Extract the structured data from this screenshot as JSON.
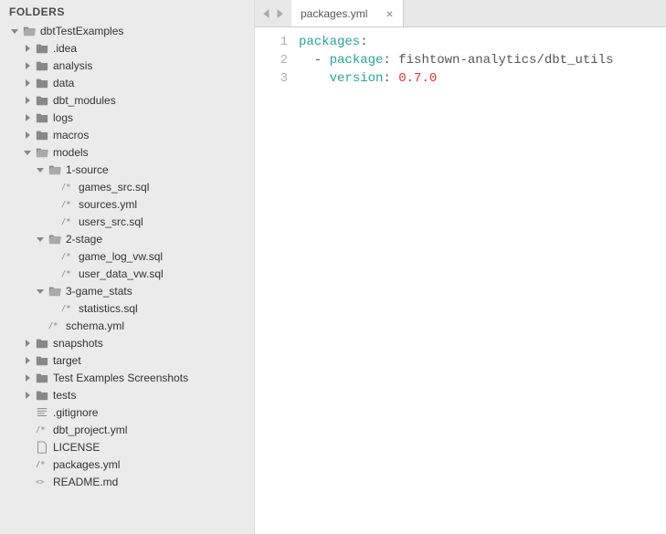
{
  "sidebar": {
    "title": "FOLDERS",
    "tree": [
      {
        "depth": 0,
        "arrow": "down",
        "icon": "folder-open",
        "label": "dbtTestExamples"
      },
      {
        "depth": 1,
        "arrow": "right",
        "icon": "folder",
        "label": ".idea"
      },
      {
        "depth": 1,
        "arrow": "right",
        "icon": "folder",
        "label": "analysis"
      },
      {
        "depth": 1,
        "arrow": "right",
        "icon": "folder",
        "label": "data"
      },
      {
        "depth": 1,
        "arrow": "right",
        "icon": "folder",
        "label": "dbt_modules"
      },
      {
        "depth": 1,
        "arrow": "right",
        "icon": "folder",
        "label": "logs"
      },
      {
        "depth": 1,
        "arrow": "right",
        "icon": "folder",
        "label": "macros"
      },
      {
        "depth": 1,
        "arrow": "down",
        "icon": "folder-open",
        "label": "models"
      },
      {
        "depth": 2,
        "arrow": "down",
        "icon": "folder-open",
        "label": "1-source"
      },
      {
        "depth": 3,
        "arrow": "blank",
        "icon": "file-code",
        "label": "games_src.sql"
      },
      {
        "depth": 3,
        "arrow": "blank",
        "icon": "file-code",
        "label": "sources.yml"
      },
      {
        "depth": 3,
        "arrow": "blank",
        "icon": "file-code",
        "label": "users_src.sql"
      },
      {
        "depth": 2,
        "arrow": "down",
        "icon": "folder-open",
        "label": "2-stage"
      },
      {
        "depth": 3,
        "arrow": "blank",
        "icon": "file-code",
        "label": "game_log_vw.sql"
      },
      {
        "depth": 3,
        "arrow": "blank",
        "icon": "file-code",
        "label": "user_data_vw.sql"
      },
      {
        "depth": 2,
        "arrow": "down",
        "icon": "folder-open",
        "label": "3-game_stats"
      },
      {
        "depth": 3,
        "arrow": "blank",
        "icon": "file-code",
        "label": "statistics.sql"
      },
      {
        "depth": 2,
        "arrow": "blank",
        "icon": "file-code",
        "label": "schema.yml"
      },
      {
        "depth": 1,
        "arrow": "right",
        "icon": "folder",
        "label": "snapshots"
      },
      {
        "depth": 1,
        "arrow": "right",
        "icon": "folder",
        "label": "target"
      },
      {
        "depth": 1,
        "arrow": "right",
        "icon": "folder",
        "label": "Test Examples Screenshots"
      },
      {
        "depth": 1,
        "arrow": "right",
        "icon": "folder",
        "label": "tests"
      },
      {
        "depth": 1,
        "arrow": "blank",
        "icon": "file-lines",
        "label": ".gitignore"
      },
      {
        "depth": 1,
        "arrow": "blank",
        "icon": "file-code",
        "label": "dbt_project.yml"
      },
      {
        "depth": 1,
        "arrow": "blank",
        "icon": "file",
        "label": "LICENSE"
      },
      {
        "depth": 1,
        "arrow": "blank",
        "icon": "file-code",
        "label": "packages.yml"
      },
      {
        "depth": 1,
        "arrow": "blank",
        "icon": "file-md",
        "label": "README.md"
      }
    ]
  },
  "editor": {
    "tab": {
      "name": "packages.yml"
    },
    "lines": [
      {
        "num": "1",
        "spans": [
          {
            "t": "packages",
            "c": "tok-key"
          },
          {
            "t": ":",
            "c": "tok-punct"
          }
        ]
      },
      {
        "num": "2",
        "spans": [
          {
            "t": "  - ",
            "c": "tok-punct"
          },
          {
            "t": "package",
            "c": "tok-key"
          },
          {
            "t": ": ",
            "c": "tok-punct"
          },
          {
            "t": "fishtown-analytics/dbt_utils",
            "c": "tok-str"
          }
        ]
      },
      {
        "num": "3",
        "spans": [
          {
            "t": "    ",
            "c": "tok-punct"
          },
          {
            "t": "version",
            "c": "tok-key"
          },
          {
            "t": ": ",
            "c": "tok-punct"
          },
          {
            "t": "0.7.0",
            "c": "tok-ver"
          }
        ]
      }
    ]
  }
}
